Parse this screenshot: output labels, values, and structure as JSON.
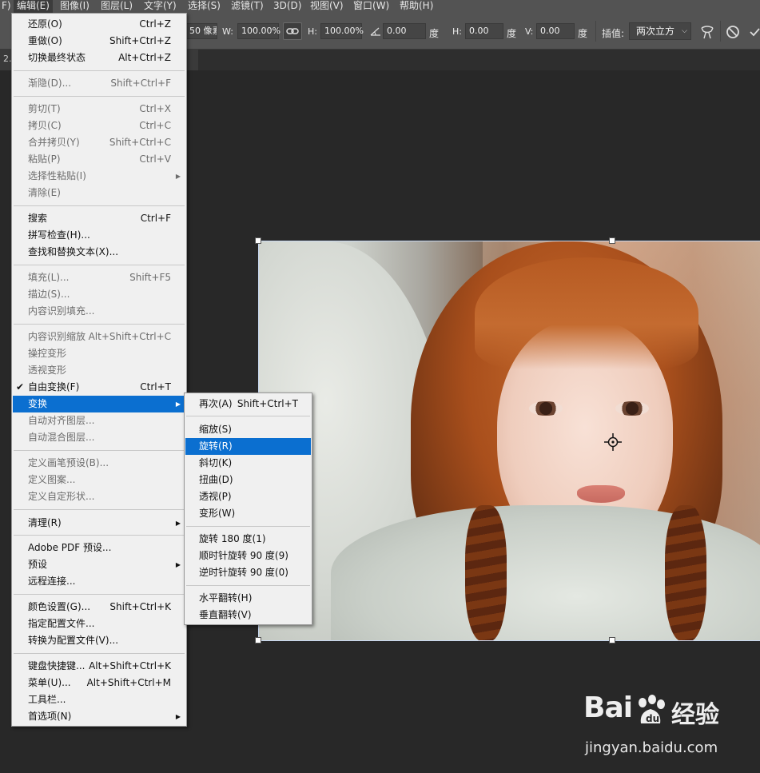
{
  "menubar": {
    "items": [
      "F)",
      "编辑(E)",
      "图像(I)",
      "图层(L)",
      "文字(Y)",
      "选择(S)",
      "滤镜(T)",
      "3D(D)",
      "视图(V)",
      "窗口(W)",
      "帮助(H)"
    ]
  },
  "optbar": {
    "partial_value": "50 像素",
    "w_label": "W:",
    "w_value": "100.00%",
    "h_label": "H:",
    "h_value": "100.00%",
    "angle_value": "0.00",
    "degree_unit": "度",
    "skew_h_label": "H:",
    "skew_h_value": "0.00",
    "skew_v_label": "V:",
    "skew_v_value": "0.00",
    "interp_label": "插值:",
    "interp_value": "两次立方"
  },
  "tab": {
    "label": "2..."
  },
  "edit_menu": {
    "items": [
      {
        "label": "还原(O)",
        "shortcut": "Ctrl+Z"
      },
      {
        "label": "重做(O)",
        "shortcut": "Shift+Ctrl+Z"
      },
      {
        "label": "切换最终状态",
        "shortcut": "Alt+Ctrl+Z"
      },
      {
        "label": "渐隐(D)...",
        "shortcut": "Shift+Ctrl+F"
      },
      {
        "label": "剪切(T)",
        "shortcut": "Ctrl+X"
      },
      {
        "label": "拷贝(C)",
        "shortcut": "Ctrl+C"
      },
      {
        "label": "合并拷贝(Y)",
        "shortcut": "Shift+Ctrl+C"
      },
      {
        "label": "粘贴(P)",
        "shortcut": "Ctrl+V"
      },
      {
        "label": "选择性粘贴(I)",
        "shortcut": ""
      },
      {
        "label": "清除(E)",
        "shortcut": ""
      },
      {
        "label": "搜索",
        "shortcut": "Ctrl+F"
      },
      {
        "label": "拼写检查(H)...",
        "shortcut": ""
      },
      {
        "label": "查找和替换文本(X)...",
        "shortcut": ""
      },
      {
        "label": "填充(L)...",
        "shortcut": "Shift+F5"
      },
      {
        "label": "描边(S)...",
        "shortcut": ""
      },
      {
        "label": "内容识别填充...",
        "shortcut": ""
      },
      {
        "label": "内容识别缩放",
        "shortcut": "Alt+Shift+Ctrl+C"
      },
      {
        "label": "操控变形",
        "shortcut": ""
      },
      {
        "label": "透视变形",
        "shortcut": ""
      },
      {
        "label": "自由变换(F)",
        "shortcut": "Ctrl+T"
      },
      {
        "label": "变换",
        "shortcut": ""
      },
      {
        "label": "自动对齐图层...",
        "shortcut": ""
      },
      {
        "label": "自动混合图层...",
        "shortcut": ""
      },
      {
        "label": "定义画笔预设(B)...",
        "shortcut": ""
      },
      {
        "label": "定义图案...",
        "shortcut": ""
      },
      {
        "label": "定义自定形状...",
        "shortcut": ""
      },
      {
        "label": "清理(R)",
        "shortcut": ""
      },
      {
        "label": "Adobe PDF 预设...",
        "shortcut": ""
      },
      {
        "label": "预设",
        "shortcut": ""
      },
      {
        "label": "远程连接...",
        "shortcut": ""
      },
      {
        "label": "颜色设置(G)...",
        "shortcut": "Shift+Ctrl+K"
      },
      {
        "label": "指定配置文件...",
        "shortcut": ""
      },
      {
        "label": "转换为配置文件(V)...",
        "shortcut": ""
      },
      {
        "label": "键盘快捷键...",
        "shortcut": "Alt+Shift+Ctrl+K"
      },
      {
        "label": "菜单(U)...",
        "shortcut": "Alt+Shift+Ctrl+M"
      },
      {
        "label": "工具栏...",
        "shortcut": ""
      },
      {
        "label": "首选项(N)",
        "shortcut": ""
      }
    ]
  },
  "transform_submenu": {
    "items": [
      {
        "label": "再次(A)",
        "shortcut": "Shift+Ctrl+T"
      },
      {
        "label": "缩放(S)",
        "shortcut": ""
      },
      {
        "label": "旋转(R)",
        "shortcut": ""
      },
      {
        "label": "斜切(K)",
        "shortcut": ""
      },
      {
        "label": "扭曲(D)",
        "shortcut": ""
      },
      {
        "label": "透视(P)",
        "shortcut": ""
      },
      {
        "label": "变形(W)",
        "shortcut": ""
      },
      {
        "label": "旋转 180 度(1)",
        "shortcut": ""
      },
      {
        "label": "顺时针旋转 90 度(9)",
        "shortcut": ""
      },
      {
        "label": "逆时针旋转 90 度(0)",
        "shortcut": ""
      },
      {
        "label": "水平翻转(H)",
        "shortcut": ""
      },
      {
        "label": "垂直翻转(V)",
        "shortcut": ""
      }
    ]
  },
  "watermark": {
    "logo": "Bai",
    "logo_suffix": "经验",
    "url": "jingyan.baidu.com"
  },
  "colors": {
    "highlight": "#0b6fd0",
    "menu_bg": "#f0f0f0",
    "workspace": "#282828",
    "toolbar": "#535353"
  }
}
